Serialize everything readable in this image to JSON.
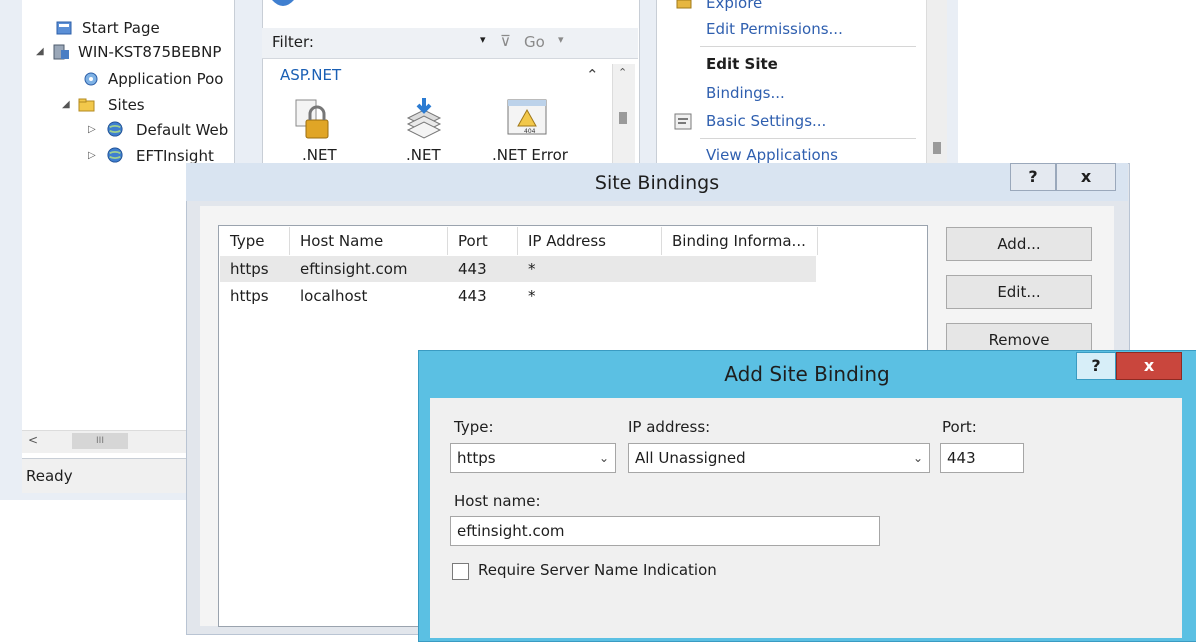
{
  "iis": {
    "tree": {
      "items": [
        {
          "label": "Start Page"
        },
        {
          "label": "WIN-KST875BEBNP"
        },
        {
          "label": "Application Poo"
        },
        {
          "label": "Sites"
        },
        {
          "label": "Default Web"
        },
        {
          "label": "EFTInsight"
        }
      ],
      "scroll_thumb": "III"
    },
    "status": "Ready",
    "filter": {
      "label": "Filter:",
      "go_label": "Go"
    },
    "group": "ASP.NET",
    "features": [
      {
        "label": ".NET"
      },
      {
        "label": ".NET"
      },
      {
        "label": ".NET Error"
      }
    ],
    "actions": {
      "explore": "Explore",
      "edit_permissions": "Edit Permissions...",
      "edit_site_header": "Edit Site",
      "bindings": "Bindings...",
      "basic_settings": "Basic Settings...",
      "view_applications": "View Applications"
    }
  },
  "site_bindings": {
    "title": "Site Bindings",
    "help": "?",
    "close": "x",
    "columns": [
      "Type",
      "Host Name",
      "Port",
      "IP Address",
      "Binding Informa..."
    ],
    "rows": [
      {
        "type": "https",
        "host": "eftinsight.com",
        "port": "443",
        "ip": "*"
      },
      {
        "type": "https",
        "host": "localhost",
        "port": "443",
        "ip": "*"
      }
    ],
    "buttons": {
      "add": "Add...",
      "edit": "Edit...",
      "remove": "Remove"
    }
  },
  "add_site_binding": {
    "title": "Add Site Binding",
    "help": "?",
    "close": "x",
    "type_label": "Type:",
    "type_value": "https",
    "ip_label": "IP address:",
    "ip_value": "All Unassigned",
    "port_label": "Port:",
    "port_value": "443",
    "host_label": "Host name:",
    "host_value": "eftinsight.com",
    "sni_label": "Require Server Name Indication"
  },
  "colors": {
    "accent_cyan": "#5bc0e3",
    "close_red": "#c9463d",
    "link_blue": "#2f5faf"
  }
}
